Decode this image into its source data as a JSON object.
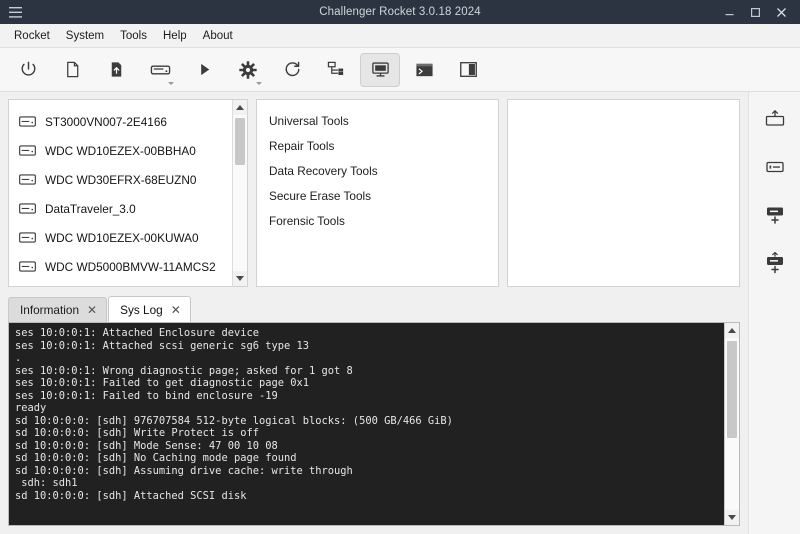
{
  "window": {
    "title": "Challenger Rocket 3.0.18 2024",
    "hamburger_icon": "hamburger-menu-icon",
    "minimize_label": "—",
    "maximize_label": "□",
    "close_label": "✕",
    "titlebar_bg": "#2b3440",
    "titlebar_fg": "#cfd5dc"
  },
  "menubar": {
    "items": [
      {
        "label": "Rocket"
      },
      {
        "label": "System"
      },
      {
        "label": "Tools"
      },
      {
        "label": "Help"
      },
      {
        "label": "About"
      }
    ]
  },
  "toolbar": {
    "buttons": [
      {
        "name": "power-icon",
        "tooltip": "Power",
        "has_caret": false,
        "active": false
      },
      {
        "name": "new-document-icon",
        "tooltip": "New",
        "has_caret": false,
        "active": false
      },
      {
        "name": "file-upload-icon",
        "tooltip": "Load",
        "has_caret": false,
        "active": false
      },
      {
        "name": "drive-icon",
        "tooltip": "Drive",
        "has_caret": true,
        "active": false
      },
      {
        "name": "play-icon",
        "tooltip": "Run",
        "has_caret": false,
        "active": false
      },
      {
        "name": "gear-icon",
        "tooltip": "Settings",
        "has_caret": true,
        "active": false
      },
      {
        "name": "refresh-icon",
        "tooltip": "Refresh",
        "has_caret": false,
        "active": false
      },
      {
        "name": "network-tree-icon",
        "tooltip": "Topology",
        "has_caret": false,
        "active": false
      },
      {
        "name": "monitor-icon",
        "tooltip": "Monitor",
        "has_caret": false,
        "active": true
      },
      {
        "name": "terminal-icon",
        "tooltip": "Terminal",
        "has_caret": false,
        "active": false
      },
      {
        "name": "split-panel-icon",
        "tooltip": "Split view",
        "has_caret": false,
        "active": false
      }
    ]
  },
  "drives_panel": {
    "items": [
      {
        "icon": "drive-icon",
        "label": "ST3000VN007-2E4166"
      },
      {
        "icon": "drive-icon",
        "label": "WDC WD10EZEX-00BBHA0"
      },
      {
        "icon": "drive-icon",
        "label": "WDC WD30EFRX-68EUZN0"
      },
      {
        "icon": "drive-icon",
        "label": "DataTraveler_3.0"
      },
      {
        "icon": "drive-icon",
        "label": "WDC WD10EZEX-00KUWA0"
      },
      {
        "icon": "drive-icon",
        "label": "WDC WD5000BMVW-11AMCS2"
      }
    ],
    "scrollbar": {
      "up_arrow": "scroll-up-icon",
      "down_arrow": "scroll-down-icon",
      "thumb_top_pct": 2,
      "thumb_height_pct": 30
    }
  },
  "tools_panel": {
    "items": [
      {
        "label": "Universal Tools"
      },
      {
        "label": "Repair Tools"
      },
      {
        "label": "Data Recovery Tools"
      },
      {
        "label": "Secure Erase Tools"
      },
      {
        "label": "Forensic Tools"
      }
    ]
  },
  "detail_panel": {
    "content": ""
  },
  "tabs": [
    {
      "label": "Information",
      "active": false,
      "close_label": "✕"
    },
    {
      "label": "Sys Log",
      "active": true,
      "close_label": "✕"
    }
  ],
  "console": {
    "text": "ses 10:0:0:1: Attached Enclosure device\nses 10:0:0:1: Attached scsi generic sg6 type 13\n.\nses 10:0:0:1: Wrong diagnostic page; asked for 1 got 8\nses 10:0:0:1: Failed to get diagnostic page 0x1\nses 10:0:0:1: Failed to bind enclosure -19\nready\nsd 10:0:0:0: [sdh] 976707584 512-byte logical blocks: (500 GB/466 GiB)\nsd 10:0:0:0: [sdh] Write Protect is off\nsd 10:0:0:0: [sdh] Mode Sense: 47 00 10 08\nsd 10:0:0:0: [sdh] No Caching mode page found\nsd 10:0:0:0: [sdh] Assuming drive cache: write through\n sdh: sdh1\nsd 10:0:0:0: [sdh] Attached SCSI disk",
    "bg": "#212121",
    "fg": "#e6e6e6",
    "scrollbar": {
      "up_arrow": "scroll-up-icon",
      "down_arrow": "scroll-down-icon",
      "thumb_top_pct": 2,
      "thumb_height_pct": 56
    }
  },
  "right_rail": {
    "buttons": [
      {
        "name": "drive-eject-icon",
        "tooltip": "Eject drive"
      },
      {
        "name": "drive-info-icon",
        "tooltip": "Drive info"
      },
      {
        "name": "drive-add-icon",
        "tooltip": "Add drive"
      },
      {
        "name": "drive-add-alt-icon",
        "tooltip": "Add drive image"
      }
    ]
  }
}
